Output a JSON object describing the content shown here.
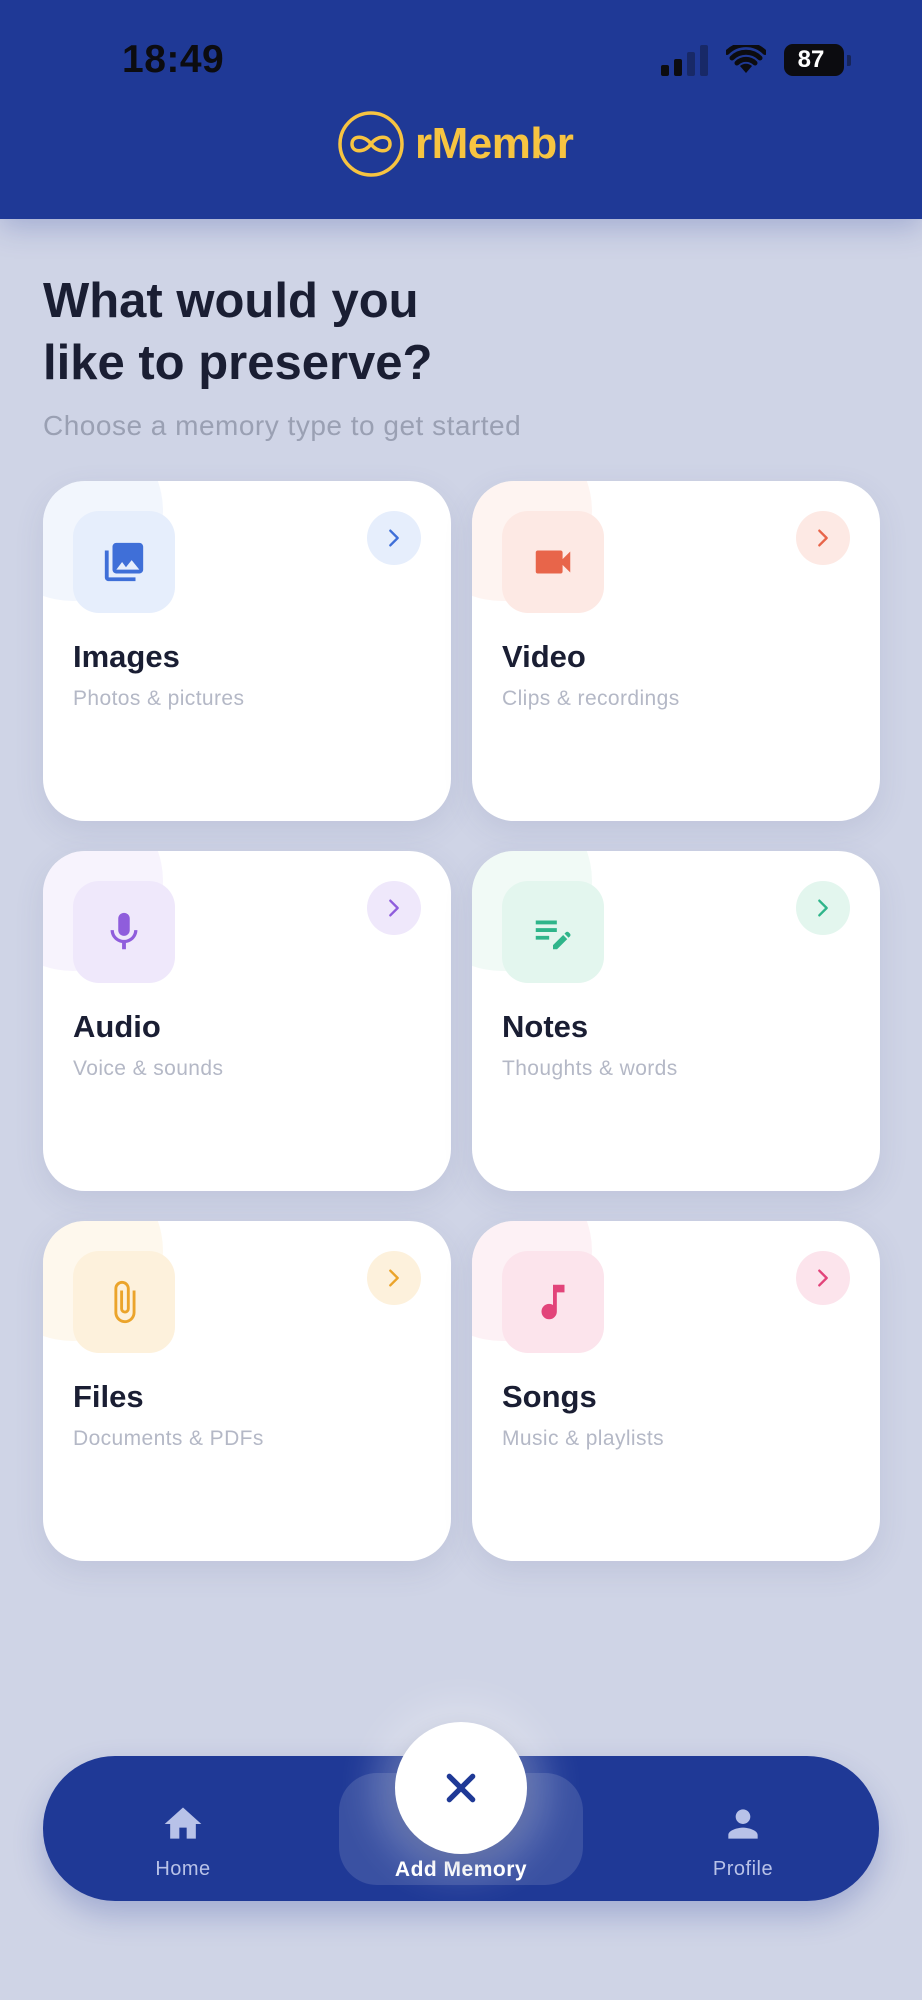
{
  "status_bar": {
    "time": "18:49",
    "battery": "87"
  },
  "header": {
    "app_name": "rMembr"
  },
  "main": {
    "title_line1": "What would you",
    "title_line2": "like to preserve?",
    "subtitle": "Choose a memory type to get started"
  },
  "cards": [
    {
      "title": "Images",
      "subtitle": "Photos & pictures",
      "icon": "image-icon",
      "color": "#3f6fd8",
      "tint": "#e6eefc"
    },
    {
      "title": "Video",
      "subtitle": "Clips & recordings",
      "icon": "video-camera-icon",
      "color": "#e8654a",
      "tint": "#fde9e4"
    },
    {
      "title": "Audio",
      "subtitle": "Voice & sounds",
      "icon": "microphone-icon",
      "color": "#8f5ddc",
      "tint": "#efe8fb"
    },
    {
      "title": "Notes",
      "subtitle": "Thoughts & words",
      "icon": "note-edit-icon",
      "color": "#2fb58a",
      "tint": "#e3f6ee"
    },
    {
      "title": "Files",
      "subtitle": "Documents & PDFs",
      "icon": "paperclip-icon",
      "color": "#eba42b",
      "tint": "#fdf1dc"
    },
    {
      "title": "Songs",
      "subtitle": "Music & playlists",
      "icon": "music-note-icon",
      "color": "#e2447a",
      "tint": "#fce4ec"
    }
  ],
  "nav": {
    "home_label": "Home",
    "add_label": "Add Memory",
    "profile_label": "Profile"
  },
  "colors": {
    "header_bg": "#1f3996",
    "logo_accent": "#f7c441",
    "page_bg": "#cfd4e6"
  }
}
